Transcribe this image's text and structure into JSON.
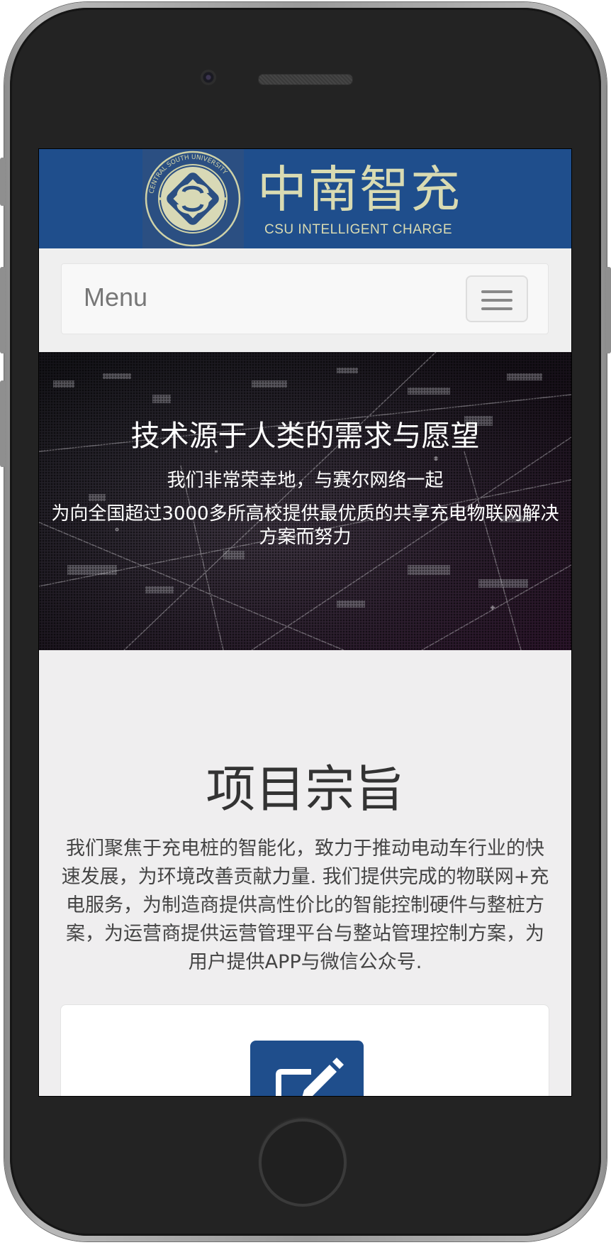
{
  "header": {
    "brand_title": "中南智充",
    "brand_subtitle": "CSU INTELLIGENT CHARGE",
    "logo_seal_text": "CENTRAL SOUTH UNIVERSITY"
  },
  "navbar": {
    "brand_label": "Menu"
  },
  "hero": {
    "headline": "技术源于人类的需求与愿望",
    "line1": "我们非常荣幸地，与赛尔网络一起",
    "line2": "为向全国超过3000多所高校提供最优质的共享充电物联网解决方案而努力"
  },
  "mission": {
    "title": "项目宗旨",
    "body": "我们聚焦于充电桩的智能化，致力于推动电动车行业的快速发展，为环境改善贡献力量. 我们提供完成的物联网+充电服务，为制造商提供高性价比的智能控制硬件与整桩方案，为运营商提供运营管理平台与整站管理控制方案，为用户提供APP与微信公众号."
  },
  "icons": {
    "menu": "hamburger-icon",
    "card": "edit-icon"
  },
  "colors": {
    "brand_blue": "#1f4e8c",
    "brand_text": "#d9dbb2",
    "page_bg": "#efeeef"
  }
}
